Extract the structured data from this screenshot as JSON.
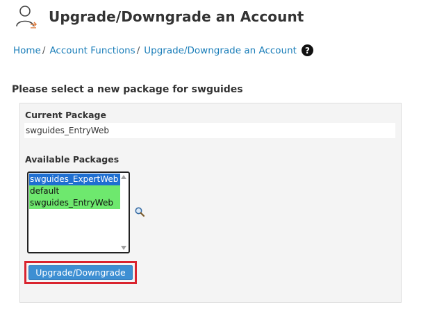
{
  "header": {
    "title": "Upgrade/Downgrade an Account",
    "icon": "user-switch-icon"
  },
  "breadcrumb": {
    "items": [
      "Home",
      "Account Functions",
      "Upgrade/Downgrade an Account"
    ],
    "separator": "/",
    "help_icon": "question-circle-icon"
  },
  "section": {
    "heading": "Please select a new package for swguides"
  },
  "form": {
    "current_package_label": "Current Package",
    "current_package_value": "swguides_EntryWeb",
    "available_packages_label": "Available Packages",
    "packages": [
      "swguides_ExpertWeb",
      "default",
      "swguides_EntryWeb"
    ],
    "selected_package": "swguides_ExpertWeb",
    "submit_label": "Upgrade/Downgrade",
    "search_icon": "magnifier-icon"
  },
  "colors": {
    "link": "#1b7eb9",
    "option_bg": "#6ee86e",
    "selected_bg": "#1f6fd1",
    "button_bg": "#3d8fd3",
    "highlight_border": "#d9232e"
  }
}
